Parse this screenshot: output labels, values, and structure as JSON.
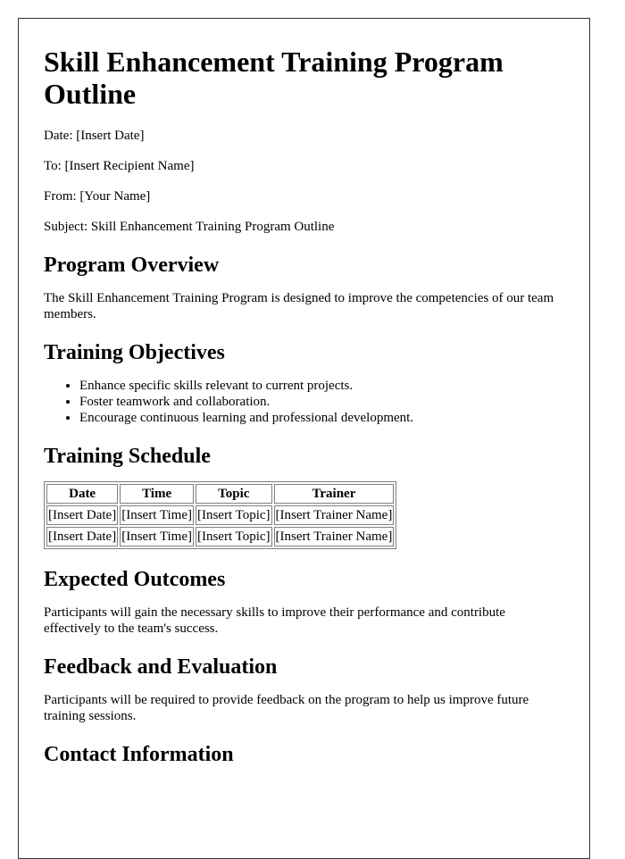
{
  "document": {
    "title": "Skill Enhancement Training Program Outline",
    "meta": {
      "date": "Date: [Insert Date]",
      "to": "To: [Insert Recipient Name]",
      "from": "From: [Your Name]",
      "subject": "Subject: Skill Enhancement Training Program Outline"
    },
    "sections": {
      "overview": {
        "heading": "Program Overview",
        "text": "The Skill Enhancement Training Program is designed to improve the competencies of our team members."
      },
      "objectives": {
        "heading": "Training Objectives",
        "items": [
          "Enhance specific skills relevant to current projects.",
          "Foster teamwork and collaboration.",
          "Encourage continuous learning and professional development."
        ]
      },
      "schedule": {
        "heading": "Training Schedule",
        "columns": [
          "Date",
          "Time",
          "Topic",
          "Trainer"
        ],
        "rows": [
          [
            "[Insert Date]",
            "[Insert Time]",
            "[Insert Topic]",
            "[Insert Trainer Name]"
          ],
          [
            "[Insert Date]",
            "[Insert Time]",
            "[Insert Topic]",
            "[Insert Trainer Name]"
          ]
        ]
      },
      "outcomes": {
        "heading": "Expected Outcomes",
        "text": "Participants will gain the necessary skills to improve their performance and contribute effectively to the team's success."
      },
      "feedback": {
        "heading": "Feedback and Evaluation",
        "text": "Participants will be required to provide feedback on the program to help us improve future training sessions."
      },
      "contact": {
        "heading": "Contact Information"
      }
    }
  },
  "colors": {
    "text": "#000000",
    "page_border": "#333333",
    "table_border": "#808080",
    "background": "#ffffff"
  }
}
